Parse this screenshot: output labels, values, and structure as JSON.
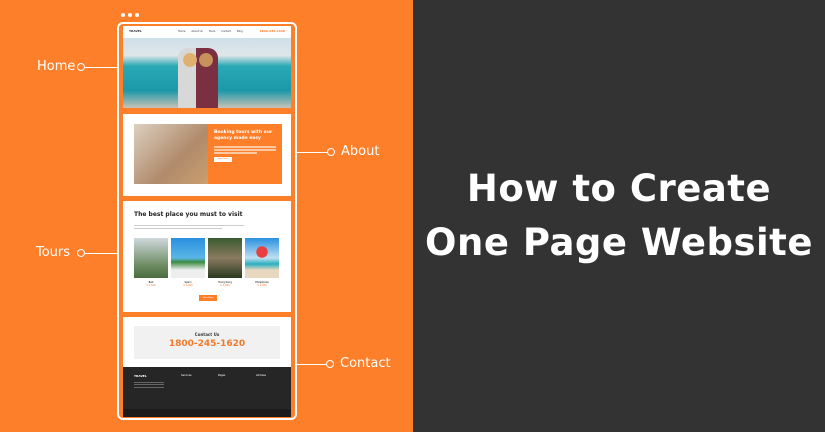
{
  "title": {
    "line1": "How to Create",
    "line2": "One Page Website"
  },
  "labels": {
    "home": "Home",
    "about": "About",
    "tours": "Tours",
    "contact": "Contact"
  },
  "mockup": {
    "logo": "TRAVEL",
    "nav": [
      "Home",
      "About Us",
      "Tours",
      "Contact",
      "Blog"
    ],
    "phone": "1800-245-1620",
    "about_heading": "Booking tours with our agency made easy",
    "about_button": "Read More",
    "tours_heading": "The best place you must to visit",
    "tours": [
      {
        "name": "Bali",
        "price": "$ 1,500"
      },
      {
        "name": "Spain",
        "price": "$ 1,200"
      },
      {
        "name": "Hong Kong",
        "price": "$ 1,800"
      },
      {
        "name": "Philippines",
        "price": "$ 1,400"
      }
    ],
    "tours_button": "View More",
    "contact_heading": "Contact Us",
    "contact_phone": "1800-245-1620",
    "footer_headings": [
      "Services",
      "Pages",
      "Address"
    ]
  },
  "colors": {
    "accent": "#fe7f2a",
    "dark": "#333333"
  }
}
